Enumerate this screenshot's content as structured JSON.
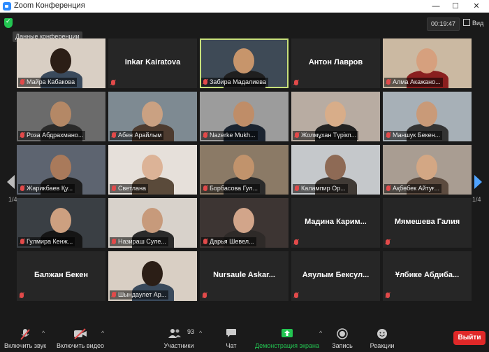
{
  "window": {
    "title": "Zoom Конференция",
    "minimize": "—",
    "maximize": "☐",
    "close": "✕"
  },
  "header": {
    "conf_label": "Данные конференции",
    "timer": "00:19:47",
    "view_label": "Вид"
  },
  "pagination": {
    "left": "1/4",
    "right": "1/4"
  },
  "colors": {
    "accent": "#2d8cff",
    "exit": "#e02828",
    "active_border": "#c7e07a",
    "muted": "#e24a4a",
    "share": "#23c552"
  },
  "tiles": [
    {
      "name": "Майра Кабакова",
      "video": true
    },
    {
      "name": "Inkar Kairatova",
      "video": false
    },
    {
      "name": "Забира Мадалиева",
      "video": true,
      "active": true
    },
    {
      "name": "Антон Лавров",
      "video": false
    },
    {
      "name": "Алма Акажано...",
      "video": true
    },
    {
      "name": "Роза Абдрахмано...",
      "video": true
    },
    {
      "name": "Абен Арайлым",
      "video": true
    },
    {
      "name": "Nazerke Mukh...",
      "video": true
    },
    {
      "name": "Жолмұхан Түрікп...",
      "video": true
    },
    {
      "name": "Маншук Бекен...",
      "video": true
    },
    {
      "name": "Жарикбаев Қу...",
      "video": true
    },
    {
      "name": "Светлана",
      "video": true
    },
    {
      "name": "Борбасова Гул...",
      "video": true
    },
    {
      "name": "Калампир Ор...",
      "video": true
    },
    {
      "name": "Ақбөбек Айтуғ...",
      "video": true
    },
    {
      "name": "Гулмира Кенж...",
      "video": true
    },
    {
      "name": "Назираш Суле...",
      "video": true
    },
    {
      "name": "Дарья Шевел...",
      "video": true
    },
    {
      "name": "Мадина  Карим...",
      "video": false
    },
    {
      "name": "Мямешева Галия",
      "video": false
    },
    {
      "name": "Балжан Бекен",
      "video": false
    },
    {
      "name": "Шындаулет Ар...",
      "video": true
    },
    {
      "name": "Nursaule  Askar...",
      "video": false
    },
    {
      "name": "Аяулым  Бексул...",
      "video": false
    },
    {
      "name": "Ұлбике  Абдиба...",
      "video": false
    }
  ],
  "toolbar": {
    "mute": "Включить звук",
    "video": "Включить видео",
    "participants": "Участники",
    "participants_count": "93",
    "chat": "Чат",
    "share": "Демонстрация экрана",
    "record": "Запись",
    "reactions": "Реакции",
    "exit": "Выйти"
  }
}
